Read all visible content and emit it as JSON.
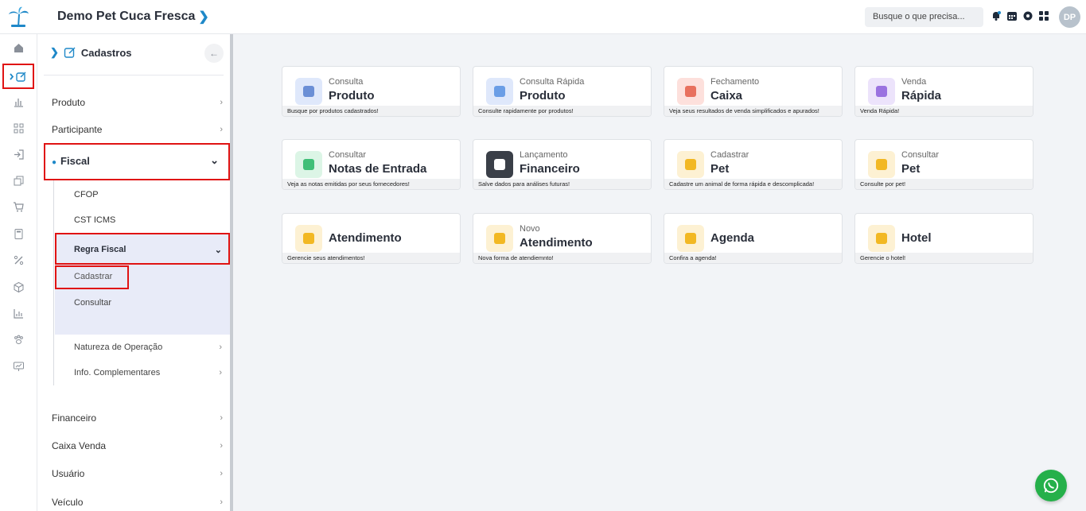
{
  "header": {
    "company": "Demo Pet Cuca Fresca",
    "search_placeholder": "Busque o que precisa...",
    "avatar": "DP"
  },
  "rail": {
    "items": [
      "home-icon",
      "cadastros-edit-icon",
      "chart-bar-icon",
      "qrcode-icon",
      "login-icon",
      "copy-icon",
      "cart-icon",
      "calculator-icon",
      "percent-icon",
      "box-icon",
      "report-chart-icon",
      "paw-icon",
      "presentation-chart-icon"
    ]
  },
  "menu": {
    "title": "Cadastros",
    "back": "←",
    "items": {
      "produto": "Produto",
      "participante": "Participante",
      "fiscal": "Fiscal",
      "financeiro": "Financeiro",
      "caixa_venda": "Caixa Venda",
      "usuario": "Usuário",
      "veiculo": "Veículo"
    },
    "fiscal_sub": {
      "cfop": "CFOP",
      "cst_icms": "CST ICMS",
      "regra_fiscal": "Regra Fiscal",
      "cadastrar": "Cadastrar",
      "consultar": "Consultar",
      "natureza": "Natureza de Operação",
      "info": "Info. Complementares"
    },
    "arrow": "›",
    "down": "⌄"
  },
  "cards": [
    {
      "small": "Consulta",
      "big": "Produto",
      "foot": "Busque por produtos cadastrados!",
      "color": "#dfe8fb",
      "accent": "#6b8fd6"
    },
    {
      "small": "Consulta Rápida",
      "big": "Produto",
      "foot": "Consulte rapidamente por produtos!",
      "color": "#dfe8fb",
      "accent": "#6b9ee6"
    },
    {
      "small": "Fechamento",
      "big": "Caixa",
      "foot": "Veja seus resultados de venda simplificados e apurados!",
      "color": "#fde0dc",
      "accent": "#e8705e"
    },
    {
      "small": "Venda",
      "big": "Rápida",
      "foot": "Venda Rápida!",
      "color": "#ece3fb",
      "accent": "#9a72e0"
    },
    {
      "small": "Consultar",
      "big": "Notas de Entrada",
      "foot": "Veja as notas emitidas por seus fornecedores!",
      "color": "#dcf5e6",
      "accent": "#3fbf77"
    },
    {
      "small": "Lançamento",
      "big": "Financeiro",
      "foot": "Salve dados para análises futuras!",
      "color": "#3a3f48",
      "accent": "#ffffff"
    },
    {
      "small": "Cadastrar",
      "big": "Pet",
      "foot": "Cadastre um animal de forma rápida e descomplicada!",
      "color": "#fdf1d3",
      "accent": "#f2b823"
    },
    {
      "small": "Consultar",
      "big": "Pet",
      "foot": "Consulte por pet!",
      "color": "#fdf1d3",
      "accent": "#f2b823"
    },
    {
      "small": "",
      "big": "Atendimento",
      "foot": "Gerencie seus atendimentos!",
      "color": "#fdf1d3",
      "accent": "#f2b823"
    },
    {
      "small": "Novo",
      "big": "Atendimento",
      "foot": "Nova forma de atendiemnto!",
      "color": "#fdf1d3",
      "accent": "#f2b823"
    },
    {
      "small": "",
      "big": "Agenda",
      "foot": "Confira a agenda!",
      "color": "#fdf1d3",
      "accent": "#f2b823"
    },
    {
      "small": "",
      "big": "Hotel",
      "foot": "Gerencie o hotel!",
      "color": "#fdf1d3",
      "accent": "#f2b823"
    }
  ]
}
